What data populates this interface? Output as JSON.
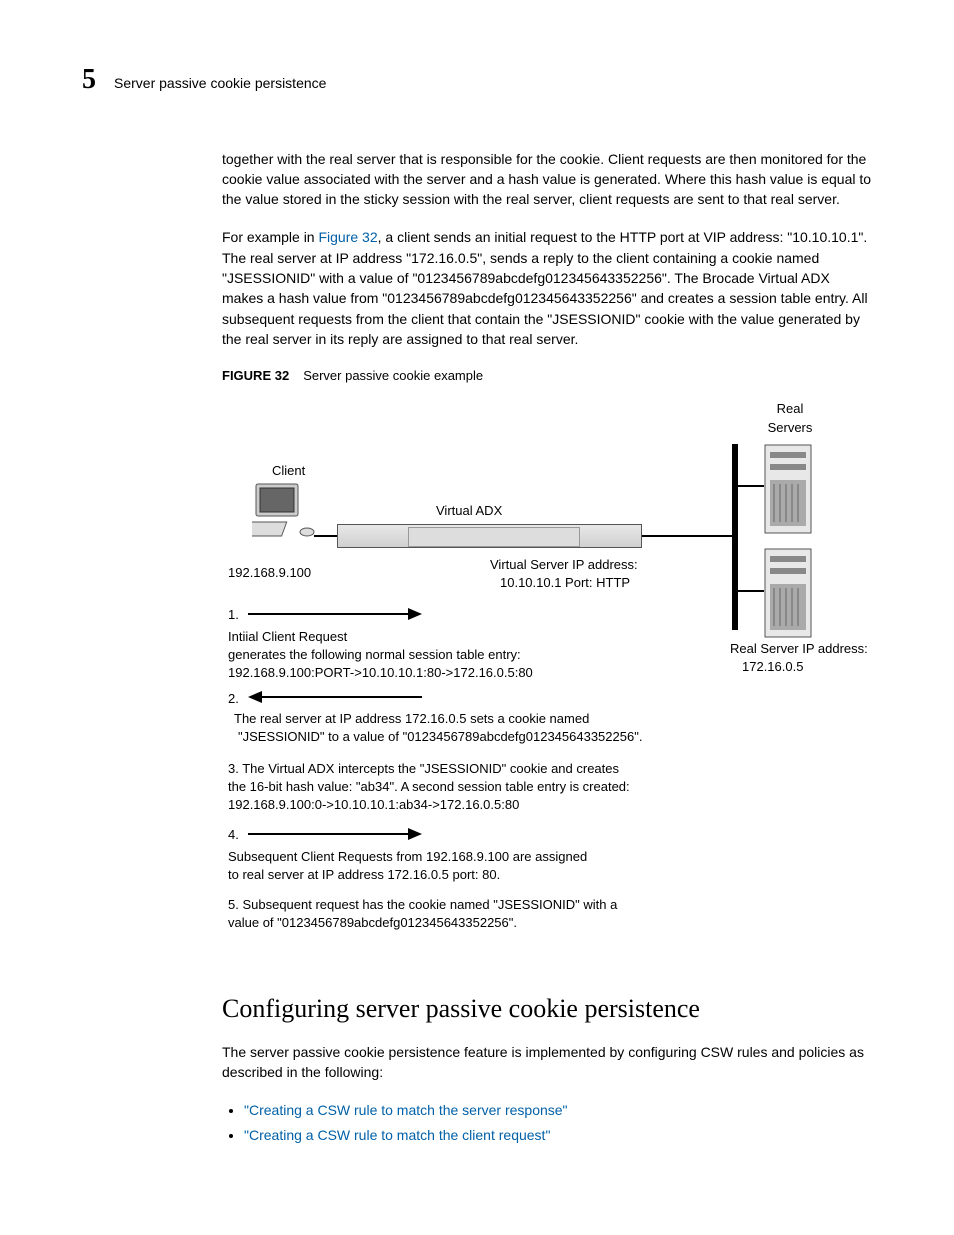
{
  "header": {
    "chapter_number": "5",
    "chapter_title": "Server passive cookie persistence"
  },
  "paragraphs": {
    "p1": "together with the real server that is responsible for the cookie. Client requests are then monitored for the cookie value associated with the server and a hash value is generated. Where this hash value is equal to the value stored in the sticky session with the real server, client requests are sent to that real server.",
    "p2a": "For example in ",
    "p2_link": "Figure 32",
    "p2b": ", a client sends an initial request to the HTTP port at VIP address: \"10.10.10.1\". The real server at IP address \"172.16.0.5\", sends a reply to the client containing a cookie named \"JSESSIONID\" with a value of \"0123456789abcdefg012345643352256\". The Brocade Virtual ADX makes a hash value from \"0123456789abcdefg012345643352256\" and creates a session table entry. All subsequent requests from the client that contain the \"JSESSIONID\" cookie with the value generated by the real server in its reply are assigned to that real server."
  },
  "figure": {
    "label_num": "FIGURE 32",
    "label_text": "Server passive cookie example",
    "labels": {
      "real_servers": "Real\nServers",
      "client": "Client",
      "virtual_adx": "Virtual ADX",
      "client_ip": "192.168.9.100",
      "vip_line1": "Virtual Server IP address:",
      "vip_line2": "10.10.10.1 Port: HTTP",
      "rs_ip1": "Real Server IP address:",
      "rs_ip2": "172.16.0.5"
    },
    "steps": {
      "s1n": "1.",
      "s1a": "Intiial Client Request",
      "s1b": "generates the following normal session table entry:",
      "s1c": "192.168.9.100:PORT->10.10.10.1:80->172.16.0.5:80",
      "s2n": "2.",
      "s2a": "The real server at IP address 172.16.0.5 sets a cookie named",
      "s2b": "\"JSESSIONID\" to a value of \"0123456789abcdefg012345643352256\".",
      "s3a": "3. The Virtual ADX intercepts the  \"JSESSIONID\" cookie and creates",
      "s3b": "the 16-bit hash value: \"ab34\". A second session table entry is created:",
      "s3c": "192.168.9.100:0->10.10.10.1:ab34->172.16.0.5:80",
      "s4n": "4.",
      "s4a": "Subsequent Client Requests from 192.168.9.100 are assigned",
      "s4b": "to real server at IP address 172.16.0.5 port: 80.",
      "s5a": "5. Subsequent request has the cookie named \"JSESSIONID\" with a",
      "s5b": "value of \"0123456789abcdefg012345643352256\"."
    }
  },
  "section2": {
    "heading": "Configuring server passive cookie persistence",
    "intro": "The server passive cookie persistence feature is implemented by configuring CSW rules and policies as described in the following:",
    "bullets": [
      "\"Creating a CSW rule to match the server response\"",
      "\"Creating a CSW rule to match the client request\""
    ]
  }
}
